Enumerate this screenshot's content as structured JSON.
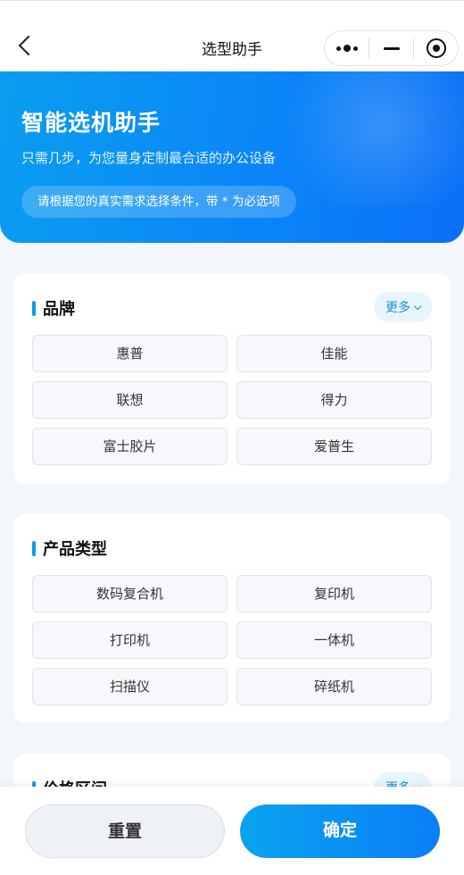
{
  "nav": {
    "title": "选型助手",
    "back_icon": "chevron-left-icon",
    "capsule_icons": [
      "more-dots-icon",
      "minimize-icon",
      "target-icon"
    ]
  },
  "hero": {
    "title": "智能选机助手",
    "subtitle": "只需几步，为您量身定制最合适的办公设备",
    "tip": "请根据您的真实需求选择条件，带 * 为必选项"
  },
  "sections": {
    "brand": {
      "title": "品牌",
      "more_label": "更多",
      "options": [
        "惠普",
        "佳能",
        "联想",
        "得力",
        "富士胶片",
        "爱普生"
      ]
    },
    "product_type": {
      "title": "产品类型",
      "options": [
        "数码复合机",
        "复印机",
        "打印机",
        "一体机",
        "扫描仪",
        "碎纸机"
      ]
    },
    "price_range": {
      "title": "价格区间",
      "more_label": "更多"
    }
  },
  "footer": {
    "reset_label": "重置",
    "confirm_label": "确定"
  },
  "colors": {
    "accent": "#0A84F8",
    "accent_light": "#0AA3EF",
    "section_bar": "#0F9DE4",
    "more_bg": "#E7F5FD",
    "page_bg": "#F3F6FB"
  }
}
